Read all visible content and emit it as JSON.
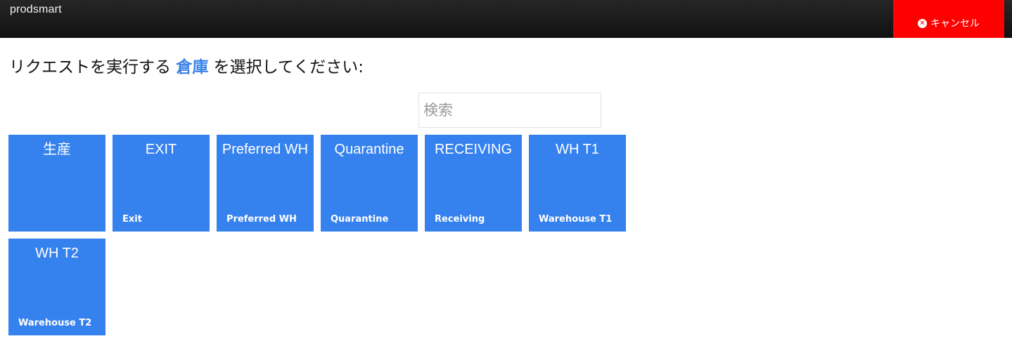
{
  "header": {
    "brand": "prodsmart",
    "cancel_label": "キャンセル",
    "cancel_icon": "close-circle-icon"
  },
  "prompt": {
    "before": "リクエストを実行する",
    "highlight": "倉庫",
    "after": "を選択してください:"
  },
  "search": {
    "placeholder": "検索",
    "value": ""
  },
  "colors": {
    "tile": "#3581ee",
    "cancel": "#ff0000",
    "highlight": "#3a82e8"
  },
  "warehouses": [
    {
      "title": "生産",
      "subtitle": ""
    },
    {
      "title": "EXIT",
      "subtitle": "Exit"
    },
    {
      "title": "Preferred WH",
      "subtitle": "Preferred WH"
    },
    {
      "title": "Quarantine",
      "subtitle": "Quarantine"
    },
    {
      "title": "RECEIVING",
      "subtitle": "Receiving"
    },
    {
      "title": "WH T1",
      "subtitle": "Warehouse T1"
    },
    {
      "title": "WH T2",
      "subtitle": "Warehouse T2"
    }
  ]
}
